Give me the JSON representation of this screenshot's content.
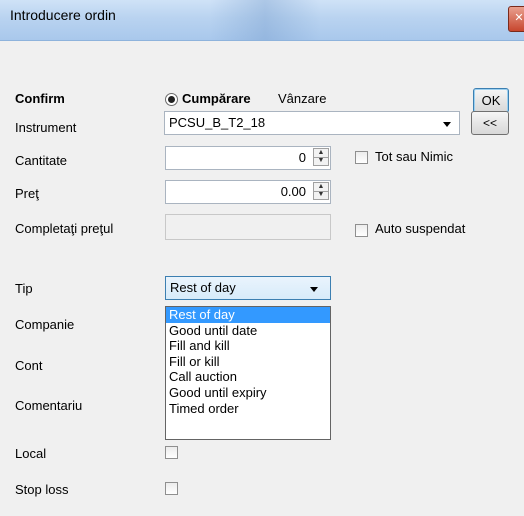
{
  "window": {
    "title": "Introducere ordin",
    "close_icon": "close-icon"
  },
  "form": {
    "confirm_label": "Confirm",
    "side": {
      "buy_label": "Cumpărare",
      "sell_label": "Vânzare",
      "selected": "Cumpărare"
    },
    "ok_label": "OK",
    "instrument": {
      "label": "Instrument",
      "value": "PCSU_B_T2_18",
      "nav_button": "<<"
    },
    "cantitate": {
      "label": "Cantitate",
      "value": "0",
      "tot_sau_nimic_label": "Tot sau Nimic"
    },
    "pret": {
      "label": "Preţ",
      "value": "0.00"
    },
    "completati": {
      "label": "Completaţi preţul",
      "value": "",
      "auto_suspendat_label": "Auto suspendat"
    },
    "tip": {
      "label": "Tip",
      "value": "Rest of day",
      "options": [
        "Rest of day",
        "Good until date",
        "Fill and kill",
        "Fill or kill",
        "Call auction",
        "Good until expiry",
        "Timed order"
      ]
    },
    "companie_label": "Companie",
    "cont_label": "Cont",
    "comentariu_label": "Comentariu",
    "local_label": "Local",
    "stop_loss_label": "Stop loss"
  },
  "colors": {
    "selection": "#3399ff",
    "titlebar": "#b9d3f0",
    "dialog_bg": "#f0f0f0"
  }
}
